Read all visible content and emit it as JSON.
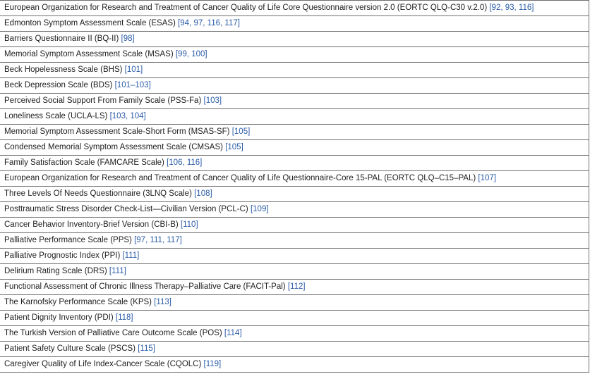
{
  "rows": [
    {
      "name": "European Organization for Research and Treatment of Cancer Quality of Life Core Questionnaire version 2.0 (EORTC QLQ-C30 v.2.0)",
      "refs": "[92, 93, 116]"
    },
    {
      "name": "Edmonton Symptom Assessment Scale (ESAS)",
      "refs": "[94, 97, 116, 117]"
    },
    {
      "name": "Barriers Questionnaire II (BQ-II)",
      "refs": "[98]"
    },
    {
      "name": "Memorial Symptom Assessment Scale (MSAS)",
      "refs": "[99, 100]"
    },
    {
      "name": "Beck Hopelessness Scale (BHS)",
      "refs": "[101]"
    },
    {
      "name": "Beck Depression Scale (BDS)",
      "refs": "[101–103]"
    },
    {
      "name": "Perceived Social Support From Family Scale (PSS-Fa)",
      "refs": "[103]"
    },
    {
      "name": "Loneliness Scale (UCLA-LS)",
      "refs": "[103, 104]"
    },
    {
      "name": "Memorial Symptom Assessment Scale-Short Form (MSAS-SF)",
      "refs": "[105]"
    },
    {
      "name": "Condensed Memorial Symptom Assessment Scale (CMSAS)",
      "refs": "[105]"
    },
    {
      "name": "Family Satisfaction Scale (FAMCARE Scale)",
      "refs": "[106, 116]"
    },
    {
      "name": "European Organization for Research and Treatment of Cancer Quality of Life Questionnaire-Core 15-PAL (EORTC QLQ–C15–PAL)",
      "refs": "[107]"
    },
    {
      "name": "Three Levels Of Needs Questionnaire (3LNQ Scale)",
      "refs": "[108]"
    },
    {
      "name": "Posttraumatic Stress Disorder Check-List—Civilian Version (PCL-C)",
      "refs": "[109]"
    },
    {
      "name": "Cancer Behavior Inventory-Brief Version (CBI-B)",
      "refs": "[110]"
    },
    {
      "name": "Palliative Performance Scale (PPS)",
      "refs": "[97, 111, 117]"
    },
    {
      "name": "Palliative Prognostic Index (PPI)",
      "refs": "[111]"
    },
    {
      "name": "Delirium Rating Scale (DRS)",
      "refs": "[111]"
    },
    {
      "name": "Functional Assessment of Chronic Illness Therapy–Palliative Care (FACIT-Pal)",
      "refs": "[112]"
    },
    {
      "name": "The Karnofsky Performance Scale (KPS)",
      "refs": "[113]"
    },
    {
      "name": "Patient Dignity Inventory (PDI)",
      "refs": "[118]"
    },
    {
      "name": "The Turkish Version of Palliative Care Outcome Scale (POS)",
      "refs": "[114]"
    },
    {
      "name": "Patient Safety Culture Scale (PSCS)",
      "refs": "[115]"
    },
    {
      "name": "Caregiver Quality of Life Index-Cancer Scale (CQOLC)",
      "refs": "[119]"
    }
  ]
}
